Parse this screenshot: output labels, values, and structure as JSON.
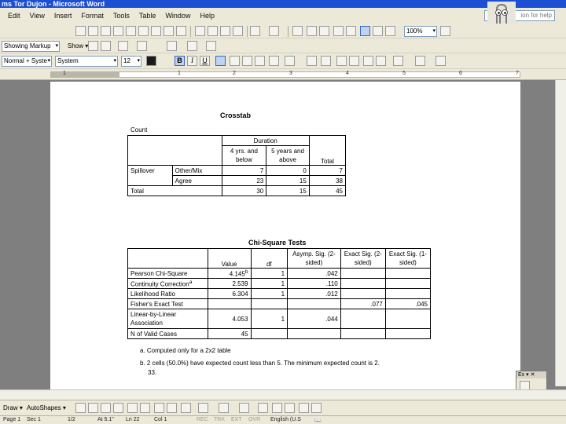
{
  "window": {
    "title": "ms Tor Dujon - Microsoft Word"
  },
  "menu": [
    "Edit",
    "View",
    "Insert",
    "Format",
    "Tools",
    "Table",
    "Window",
    "Help"
  ],
  "help": {
    "placeholder": "ion for help"
  },
  "toolbar": {
    "zoom": "100%",
    "markup_label": "Showing Markup",
    "show_label": "Show",
    "style": "Normal + Syste",
    "font": "System",
    "font_size": "12"
  },
  "document": {
    "crosstab": {
      "title": "Crosstab",
      "count_label": "Count",
      "duration_header": "Duration",
      "col1": "4 yrs. and below",
      "col2": "5 years and above",
      "col_total": "Total",
      "row_group": "Spillover",
      "rows": [
        {
          "label": "Other/Mix",
          "v1": "7",
          "v2": "0",
          "total": "7"
        },
        {
          "label": "Agree",
          "v1": "23",
          "v2": "15",
          "total": "38"
        }
      ],
      "total_row": {
        "label": "Total",
        "v1": "30",
        "v2": "15",
        "total": "45"
      }
    },
    "chisq": {
      "title": "Chi-Square Tests",
      "headers": [
        "Value",
        "df",
        "Asymp. Sig. (2-sided)",
        "Exact Sig. (2-sided)",
        "Exact Sig. (1-sided)"
      ],
      "rows": [
        {
          "label": "Pearson Chi-Square",
          "value": "4.145",
          "sup": "b",
          "df": "1",
          "asymp": ".042",
          "exact2": "",
          "exact1": ""
        },
        {
          "label": "Continuity Correction",
          "sup": "a",
          "value": "2.539",
          "df": "1",
          "asymp": ".110",
          "exact2": "",
          "exact1": ""
        },
        {
          "label": "Likelihood Ratio",
          "value": "6.304",
          "sup": "",
          "df": "1",
          "asymp": ".012",
          "exact2": "",
          "exact1": ""
        },
        {
          "label": "Fisher's Exact Test",
          "value": "",
          "sup": "",
          "df": "",
          "asymp": "",
          "exact2": ".077",
          "exact1": ".045"
        },
        {
          "label": "Linear-by-Linear Association",
          "value": "4.053",
          "sup": "",
          "df": "1",
          "asymp": ".044",
          "exact2": "",
          "exact1": ""
        },
        {
          "label": "N of Valid Cases",
          "value": "45",
          "sup": "",
          "df": "",
          "asymp": "",
          "exact2": "",
          "exact1": ""
        }
      ],
      "footnote_a": "a. Computed only for a 2x2 table",
      "footnote_b": "b. 2 cells (50.0%) have expected count less than 5. The minimum expected count is 2.",
      "footnote_b2": "33."
    }
  },
  "ruler": {
    "marks": [
      "1",
      "1",
      "2",
      "3",
      "4",
      "5",
      "6",
      "7"
    ]
  },
  "drawbar": {
    "draw": "Draw",
    "autoshapes": "AutoShapes"
  },
  "status": {
    "page": "Page 1",
    "sec": "Sec 1",
    "pages": "1/2",
    "at": "At 5.1\"",
    "ln": "Ln 22",
    "col": "Col 1",
    "rec": "REC",
    "trk": "TRK",
    "ext": "EXT",
    "ovr": "OVR",
    "lang": "English (U.S"
  },
  "colors": {
    "titlebar": "#1c4fd2",
    "chrome": "#ece9d8",
    "selected": "#c1d2ee"
  }
}
